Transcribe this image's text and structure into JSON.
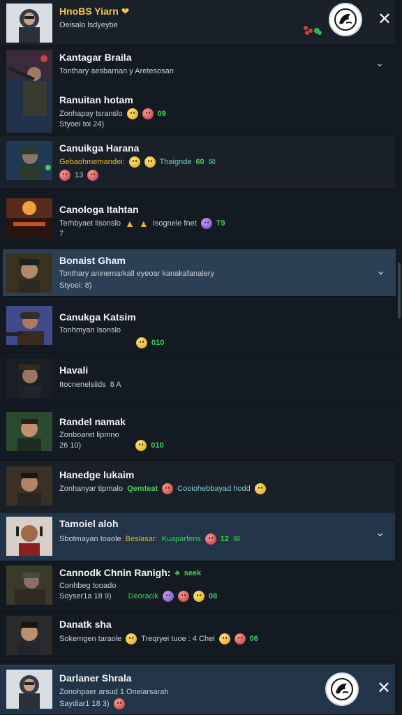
{
  "top": {
    "name": "HnoBS Yiarn ❤",
    "sub": "Oeisalo lsdyeybe",
    "logo_icon": "wolf-emblem-icon",
    "close_icon": "close-icon"
  },
  "rows": [
    {
      "name": "Kantagar Braila",
      "l1": "Tonthary aesbarnan y Aretesosan",
      "l2": "",
      "extra": ""
    },
    {
      "name": "Ranuitan hotam",
      "l1": "Zonhapay tsranslo",
      "l2": "Styoei toi 24)",
      "badge": "09"
    },
    {
      "name": "Canuikga Harana",
      "l1": "Gebaohmemandei:",
      "l1b": "Thaignde",
      "badge": "60",
      "l2": "13"
    },
    {
      "name": "Canologa Itahtan",
      "l1": "Terhbyaet lisonslo",
      "l1b": "Isognele fnet",
      "badge": "T9",
      "l2": "7"
    },
    {
      "name": "Bonaist Gham",
      "l1": "Tonthary aninemarkall eyeoar kanakafanalery",
      "l2": "Styoei: 8)"
    },
    {
      "name": "Canukga Katsim",
      "l1": "Tonhmyan lsonslo",
      "badge": "010"
    },
    {
      "name": "Havali",
      "l1": "Itocnenelsiids",
      "l1b": "8 A"
    },
    {
      "name": "Randel namak",
      "l1": "Zonboaret lipmno",
      "l2": "26 10)",
      "badge": "010"
    },
    {
      "name": "Hanedge lukaim",
      "l1": "Zonhanyar tipmalo",
      "l1b": "Qemteat",
      "l1c": "Cooiohebbayad hodd"
    },
    {
      "name": "Tamoiel aloh",
      "l1": "Sbotmayan toaole",
      "l1b": "Beslasar:",
      "l1c": "Kuaparfens",
      "badge": "12"
    },
    {
      "name": "Cannodk Chnin Ranigh:",
      "name_extra": "seek",
      "l1": "Conhbeg tooado",
      "l2": "Soyser1a 18 9)",
      "l1b": "Deoracik",
      "badge": "08"
    },
    {
      "name": "Danatk sha",
      "l1": "Sokemgen taraole",
      "l1b": "Treqryei tuoe : 4 Chel",
      "badge": "06"
    },
    {
      "name": "Darlaner Shrala",
      "l1": "Zonohpaer arsud 1 Oneiarsarah",
      "l2": "Saydiar1 18 3)"
    }
  ],
  "icons": {
    "chevron": "chevron-down-icon",
    "close": "close-icon"
  }
}
